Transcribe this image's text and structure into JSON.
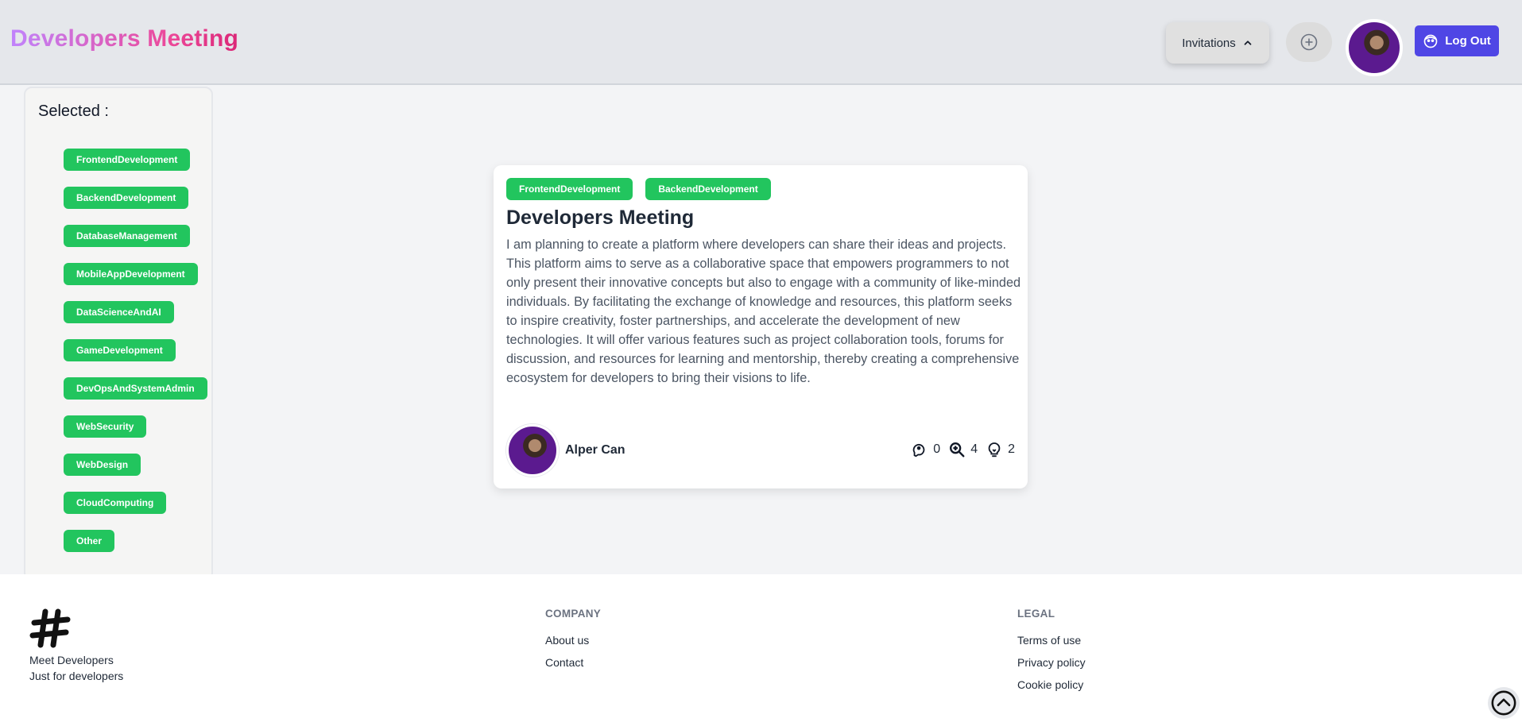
{
  "header": {
    "brand": "Developers Meeting",
    "invitations_label": "Invitations",
    "logout_label": "Log Out"
  },
  "sidebar": {
    "title": "Selected :",
    "tags": [
      "FrontendDevelopment",
      "BackendDevelopment",
      "DatabaseManagement",
      "MobileAppDevelopment",
      "DataScienceAndAI",
      "GameDevelopment",
      "DevOpsAndSystemAdmin",
      "WebSecurity",
      "WebDesign",
      "CloudComputing",
      "Other"
    ]
  },
  "post": {
    "tags": [
      "FrontendDevelopment",
      "BackendDevelopment"
    ],
    "title": "Developers Meeting",
    "description": "I am planning to create a platform where developers can share their ideas and projects. This platform aims to serve as a collaborative space that empowers programmers to not only present their innovative concepts but also to engage with a community of like-minded individuals. By facilitating the exchange of knowledge and resources, this platform seeks to inspire creativity, foster partnerships, and accelerate the development of new technologies. It will offer various features such as project collaboration tools, forums for discussion, and resources for learning and mentorship, thereby creating a comprehensive ecosystem for developers to bring their visions to life.",
    "author": "Alper Can",
    "stats": {
      "comments": "0",
      "views": "4",
      "ideas": "2"
    }
  },
  "footer": {
    "tagline_line1": "Meet Developers",
    "tagline_line2": "Just for developers",
    "company_heading": "COMPANY",
    "company_links": [
      "About us",
      "Contact"
    ],
    "legal_heading": "LEGAL",
    "legal_links": [
      "Terms of use",
      "Privacy policy",
      "Cookie policy"
    ]
  },
  "colors": {
    "tag_green": "#22c55e",
    "logout_indigo": "#4f46e5",
    "brand_gradient_start": "#c084fc",
    "brand_gradient_end": "#db2777"
  }
}
